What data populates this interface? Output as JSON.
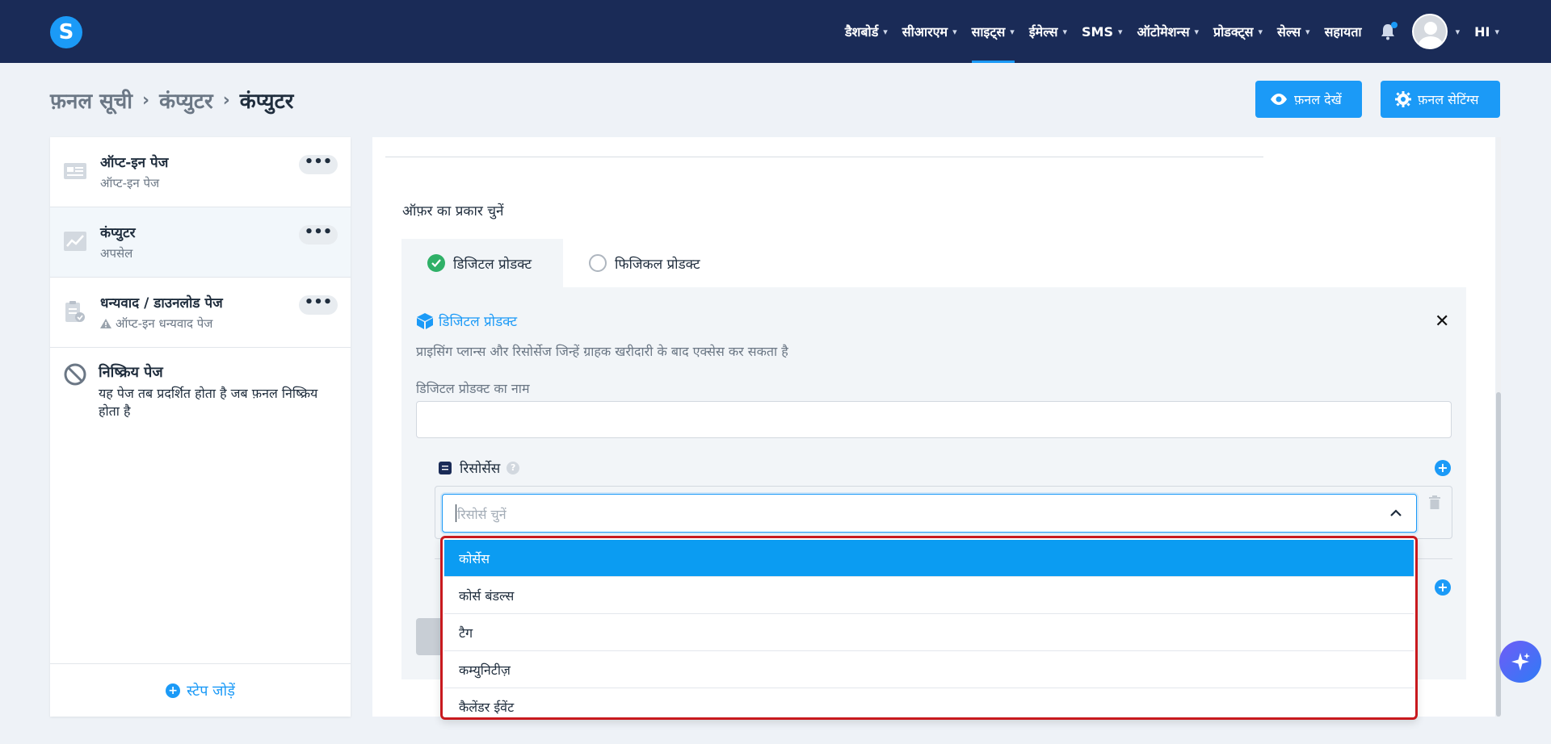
{
  "nav": {
    "items": [
      {
        "label": "डैशबोर्ड",
        "chevron": true,
        "active": false
      },
      {
        "label": "सीआरएम",
        "chevron": true,
        "active": false
      },
      {
        "label": "साइट्स",
        "chevron": true,
        "active": true
      },
      {
        "label": "ईमेल्स",
        "chevron": true,
        "active": false
      },
      {
        "label": "SMS",
        "chevron": true,
        "active": false
      },
      {
        "label": "ऑटोमेशन्स",
        "chevron": true,
        "active": false
      },
      {
        "label": "प्रोडक्ट्स",
        "chevron": true,
        "active": false
      },
      {
        "label": "सेल्स",
        "chevron": true,
        "active": false
      },
      {
        "label": "सहायता",
        "chevron": false,
        "active": false
      }
    ],
    "language": "HI"
  },
  "logo": {
    "letter": "S"
  },
  "breadcrumb": {
    "items": [
      "फ़नल सूची",
      "कंप्युटर",
      "कंप्युटर"
    ]
  },
  "header": {
    "view_funnel": "फ़नल देखें",
    "funnel_settings": "फ़नल सेटिंग्स"
  },
  "sidebar": {
    "steps": [
      {
        "title": "ऑप्ट-इन पेज",
        "subtitle": "ऑप्ट-इन पेज",
        "icon": "optin-page-icon",
        "warning": false
      },
      {
        "title": "कंप्युटर",
        "subtitle": "अपसेल",
        "icon": "chart-icon",
        "warning": false
      },
      {
        "title": "धन्यवाद / डाउनलोड पेज",
        "subtitle": "ऑप्ट-इन धन्यवाद पेज",
        "icon": "clipboard-check-icon",
        "warning": true
      }
    ],
    "inactive": {
      "title": "निष्क्रिय पेज",
      "description": "यह पेज तब प्रदर्शित होता है जब फ़नल निष्क्रिय होता है"
    },
    "add_step": "स्टेप जोड़ें"
  },
  "offer": {
    "label": "ऑफ़र का प्रकार चुनें",
    "tabs": [
      {
        "label": "डिजिटल प्रोडक्ट",
        "selected": true
      },
      {
        "label": "फिजिकल प्रोडक्ट",
        "selected": false
      }
    ]
  },
  "digital_product": {
    "title": "डिजिटल प्रोडक्ट",
    "description": "प्राइसिंग प्लान्स और रिसोर्सेज जिन्हें ग्राहक खरीदारी के बाद एक्सेस कर सकता है",
    "name_label": "डिजिटल प्रोडक्ट का नाम",
    "name_value": "",
    "resources_label": "रिसोर्सेस",
    "select_placeholder": "रिसोर्स चुनें"
  },
  "dropdown": {
    "options": [
      "कोर्सेस",
      "कोर्स बंडल्स",
      "टैग",
      "कम्युनिटीज़",
      "कैलेंडर ईवेंट"
    ],
    "highlighted_index": 0
  },
  "colors": {
    "nav_bg": "#1a2b57",
    "accent": "#1b9af7",
    "highlight_border": "#c8191e",
    "success": "#2fb067"
  }
}
